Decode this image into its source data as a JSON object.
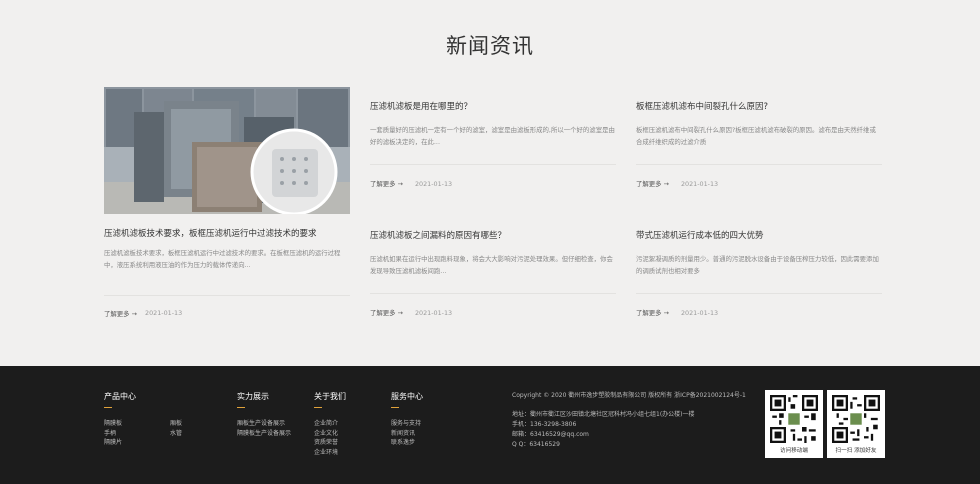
{
  "section_title": "新闻资讯",
  "featured": {
    "title": "压滤机滤板技术要求，板框压滤机运行中过滤技术的要求",
    "desc": "压滤机滤板技术要求，板框压滤机运行中过滤技术的要求。在板框压滤机的运行过程中，液压系统利用液压油的作为压力的载体传递向...",
    "more": "了解更多 →",
    "date": "2021-01-13"
  },
  "news": [
    {
      "title": "压滤机滤板是用在哪里的？",
      "desc": "一套质量好的压滤机一定有一个好的滤室，滤室是由滤板形成的,所以一个好的滤室是由好的滤板决定的，在此...",
      "more": "了解更多 →",
      "date": "2021-01-13"
    },
    {
      "title": "板框压滤机滤布中间裂孔什么原因?",
      "desc": "板框压滤机滤布中间裂孔什么原因?板框压滤机滤布破裂的原因。滤布是由天然纤维或合成纤维织成的过滤介质",
      "more": "了解更多 →",
      "date": "2021-01-13"
    },
    {
      "title": "压滤机滤板之间漏料的原因有哪些？",
      "desc": "压滤机如果在运行中出现跑料现象，将会大大影响对污泥处理效果。但仔细检查，你会发现导致压滤机滤板间跑...",
      "more": "了解更多 →",
      "date": "2021-01-13"
    },
    {
      "title": "带式压滤机运行成本低的四大优势",
      "desc": "污泥絮凝调质的剂量用少。普通的污泥脱水设备由于设备压榨压力较低，因此需要添加的调质试剂也相对要多",
      "more": "了解更多 →",
      "date": "2021-01-13"
    }
  ],
  "footer": {
    "products": {
      "title": "产品中心",
      "links_a": [
        "隔膜板",
        "手柄",
        "隔膜片"
      ],
      "links_b": [
        "厢板",
        "水管"
      ]
    },
    "strength": {
      "title": "实力展示",
      "links": [
        "厢板生产设备展示",
        "隔膜板生产设备展示"
      ]
    },
    "about": {
      "title": "关于我们",
      "links": [
        "企业简介",
        "企业文化",
        "资质荣誉",
        "企业环境"
      ]
    },
    "service": {
      "title": "服务中心",
      "links": [
        "服务与支持",
        "新闻资讯",
        "联系逸步"
      ]
    },
    "info": {
      "copyright": "Copyright © 2020  衢州市逸步塑胶制品有限公司 版权所有  浙ICP备2021002124号-1",
      "address": "地址：衢州市衢江区沙田镇北塘社区冠科村冯小组七组1(办公楼)一楼",
      "phone": "手机：136-3298-3806",
      "email": "邮箱：63416529@qq.com",
      "qq": "Q Q：63416529"
    },
    "qr": [
      {
        "caption": "访问移动端"
      },
      {
        "caption": "扫一扫 添加好友"
      }
    ]
  }
}
